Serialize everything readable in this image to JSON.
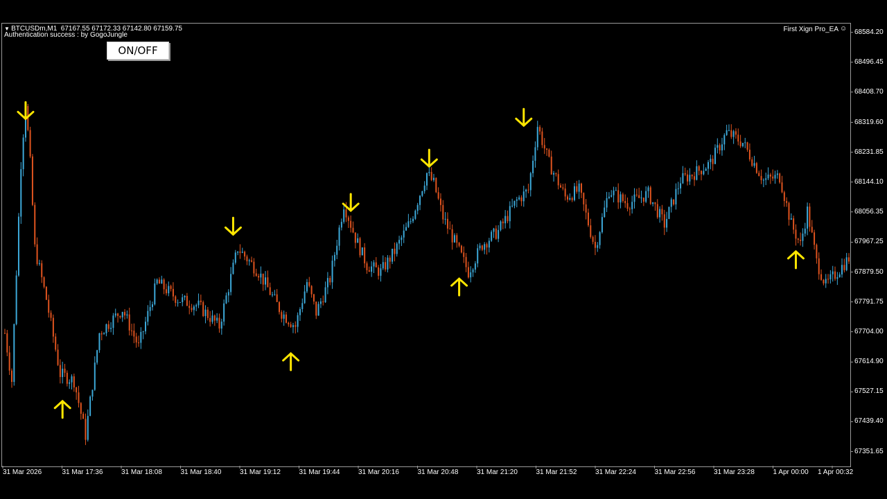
{
  "header": {
    "symbol_info": "BTCUSDm,M1  67167.55 67172.33 67142.80 67159.75",
    "auth_text": "Authentication success : by GogoJungle",
    "ea_name": "First Xign Pro_EA",
    "ea_icon": "smiley-icon"
  },
  "controls": {
    "toggle_label": "ON/OFF",
    "collapse_icon": "triangle-down-icon"
  },
  "colors": {
    "background": "#000000",
    "bull": "#3da9d9",
    "bear": "#e0541f",
    "signal": "#ffe600",
    "text": "#ffffff"
  },
  "chart_data": {
    "type": "candlestick",
    "symbol": "BTCUSDm",
    "timeframe": "M1",
    "ylim": [
      67310,
      68606
    ],
    "y_ticks": [
      "68584.20",
      "68496.45",
      "68408.70",
      "68319.60",
      "68231.85",
      "68144.10",
      "68056.35",
      "67967.25",
      "67879.50",
      "67791.75",
      "67704.00",
      "67614.90",
      "67527.15",
      "67439.40",
      "67351.65"
    ],
    "x_ticks": [
      "31 Mar 2026",
      "31 Mar 17:36",
      "31 Mar 18:08",
      "31 Mar 18:40",
      "31 Mar 19:12",
      "31 Mar 19:44",
      "31 Mar 20:16",
      "31 Mar 20:48",
      "31 Mar 21:20",
      "31 Mar 21:52",
      "31 Mar 22:24",
      "31 Mar 22:56",
      "31 Mar 23:28",
      "1 Apr 00:00",
      "1 Apr 00:32"
    ],
    "price_path": [
      [
        0,
        67700
      ],
      [
        3,
        67560
      ],
      [
        7,
        68200
      ],
      [
        9,
        68380
      ],
      [
        11,
        68200
      ],
      [
        13,
        67950
      ],
      [
        18,
        67800
      ],
      [
        24,
        67580
      ],
      [
        30,
        67560
      ],
      [
        35,
        67400
      ],
      [
        41,
        67700
      ],
      [
        51,
        67770
      ],
      [
        58,
        67660
      ],
      [
        66,
        67850
      ],
      [
        75,
        67800
      ],
      [
        84,
        67780
      ],
      [
        93,
        67720
      ],
      [
        101,
        67950
      ],
      [
        110,
        67880
      ],
      [
        120,
        67760
      ],
      [
        126,
        67720
      ],
      [
        131,
        67850
      ],
      [
        135,
        67760
      ],
      [
        141,
        67860
      ],
      [
        147,
        68080
      ],
      [
        152,
        67980
      ],
      [
        157,
        67900
      ],
      [
        163,
        67880
      ],
      [
        169,
        67940
      ],
      [
        176,
        68030
      ],
      [
        183,
        68170
      ],
      [
        186,
        68140
      ],
      [
        190,
        68040
      ],
      [
        197,
        67940
      ],
      [
        201,
        67880
      ],
      [
        207,
        67960
      ],
      [
        214,
        68000
      ],
      [
        222,
        68090
      ],
      [
        227,
        68120
      ],
      [
        231,
        68310
      ],
      [
        236,
        68200
      ],
      [
        243,
        68100
      ],
      [
        249,
        68120
      ],
      [
        256,
        67950
      ],
      [
        262,
        68120
      ],
      [
        270,
        68080
      ],
      [
        279,
        68110
      ],
      [
        286,
        68020
      ],
      [
        293,
        68150
      ],
      [
        299,
        68170
      ],
      [
        306,
        68200
      ],
      [
        313,
        68290
      ],
      [
        320,
        68260
      ],
      [
        329,
        68150
      ],
      [
        336,
        68160
      ],
      [
        341,
        68020
      ],
      [
        345,
        67960
      ],
      [
        348,
        68060
      ],
      [
        352,
        67910
      ],
      [
        356,
        67840
      ],
      [
        361,
        67880
      ],
      [
        366,
        67920
      ]
    ],
    "signals": [
      {
        "direction": "down",
        "x": 9,
        "price": 68330
      },
      {
        "direction": "up",
        "x": 25,
        "price": 67500
      },
      {
        "direction": "down",
        "x": 99,
        "price": 67990
      },
      {
        "direction": "up",
        "x": 124,
        "price": 67640
      },
      {
        "direction": "down",
        "x": 150,
        "price": 68060
      },
      {
        "direction": "down",
        "x": 184,
        "price": 68190
      },
      {
        "direction": "up",
        "x": 197,
        "price": 67860
      },
      {
        "direction": "down",
        "x": 225,
        "price": 68310
      },
      {
        "direction": "up",
        "x": 343,
        "price": 67940
      }
    ],
    "bar_count": 367
  }
}
